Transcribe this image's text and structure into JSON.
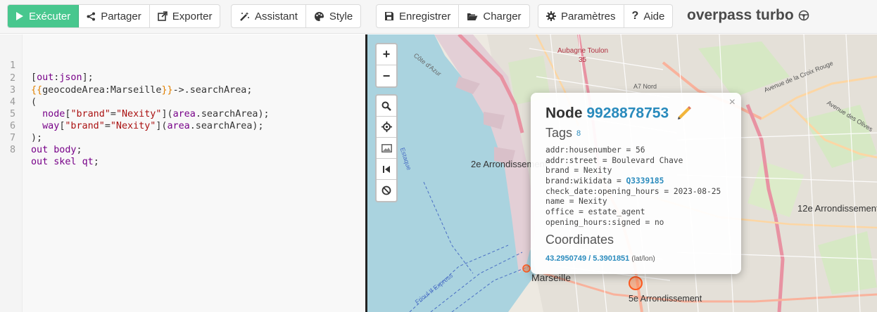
{
  "toolbar": {
    "run_label": "Exécuter",
    "share_label": "Partager",
    "export_label": "Exporter",
    "wizard_label": "Assistant",
    "style_label": "Style",
    "save_label": "Enregistrer",
    "load_label": "Charger",
    "settings_label": "Paramètres",
    "help_label": "Aide",
    "brand": "overpass turbo"
  },
  "editor": {
    "line_numbers": [
      "1",
      "2",
      "3",
      "4",
      "5",
      "6",
      "7",
      "8"
    ]
  },
  "map": {
    "labels": {
      "aubagne": "Aubagne Toulon",
      "arr2": "2e Arrondissement",
      "arr12": "12e Arrondissement",
      "arr5": "5e Arrondissement",
      "marseille": "Marseille",
      "croix_rouge": "Avenue de la Croix Rouge",
      "olives": "Avenue des Olives",
      "a7nord": "A7 Nord",
      "a50": "35",
      "estaque": "Estaque",
      "if_express": "Frioul If Express",
      "cote_azur": "Côte d'Azur"
    },
    "controls": {
      "zoom_in": "+",
      "zoom_out": "−"
    }
  },
  "popup": {
    "title_prefix": "Node",
    "node_id": "9928878753",
    "tags_heading": "Tags",
    "tags_count": "8",
    "tags": [
      {
        "key": "addr:housenumber",
        "value": "56"
      },
      {
        "key": "addr:street",
        "value": "Boulevard Chave"
      },
      {
        "key": "brand",
        "value": "Nexity"
      },
      {
        "key": "brand:wikidata",
        "value": "Q3339185"
      },
      {
        "key": "check_date:opening_hours",
        "value": "2023-08-25"
      },
      {
        "key": "name",
        "value": "Nexity"
      },
      {
        "key": "office",
        "value": "estate_agent"
      },
      {
        "key": "opening_hours:signed",
        "value": "no"
      }
    ],
    "coords_heading": "Coordinates",
    "lat": "43.2950749",
    "lon": "5.3901851",
    "coords_sep": " / ",
    "coords_unit": "(lat/lon)",
    "close": "×"
  },
  "colors": {
    "run": "#48c78e",
    "link": "#2a8bbd",
    "sea": "#aad3df"
  }
}
